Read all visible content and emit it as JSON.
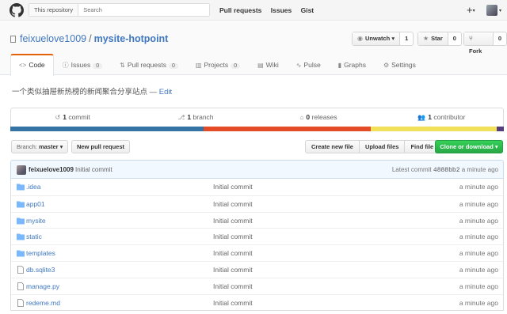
{
  "header": {
    "scope": "This repository",
    "search_placeholder": "Search",
    "nav": [
      "Pull requests",
      "Issues",
      "Gist"
    ],
    "plus": "+",
    "caret": "▾"
  },
  "repo": {
    "owner": "feixuelove1009",
    "separator": "/",
    "name": "mysite-hotpoint",
    "watch": {
      "label": "Unwatch ▾",
      "count": "1"
    },
    "star": {
      "label": "Star",
      "count": "0"
    },
    "fork": {
      "label": "Fork",
      "count": "0"
    }
  },
  "tabs": [
    {
      "label": "Code",
      "count": ""
    },
    {
      "label": "Issues",
      "count": "0"
    },
    {
      "label": "Pull requests",
      "count": "0"
    },
    {
      "label": "Projects",
      "count": "0"
    },
    {
      "label": "Wiki",
      "count": ""
    },
    {
      "label": "Pulse",
      "count": ""
    },
    {
      "label": "Graphs",
      "count": ""
    },
    {
      "label": "Settings",
      "count": ""
    }
  ],
  "description": {
    "text": "一个类似抽屉新热榜的新闻聚合分享站点",
    "dash": "—",
    "edit": "Edit"
  },
  "summary": {
    "commits": {
      "num": "1",
      "label": "commit"
    },
    "branches": {
      "num": "1",
      "label": "branch"
    },
    "releases": {
      "num": "0",
      "label": "releases"
    },
    "contributors": {
      "num": "1",
      "label": "contributor"
    }
  },
  "lang_colors": [
    "#3572a5",
    "#e34c26",
    "#f1e05a",
    "#563d7c"
  ],
  "lang_shares": [
    0.391,
    0.34,
    0.254,
    0.015
  ],
  "toolbar": {
    "branch_prefix": "Branch:",
    "branch": "master ▾",
    "new_pr": "New pull request",
    "create_file": "Create new file",
    "upload": "Upload files",
    "find": "Find file",
    "clone": "Clone or download ▾"
  },
  "commit": {
    "user": "feixuelove1009",
    "message": "Initial commit",
    "latest_label": "Latest commit",
    "sha": "4888bb2",
    "age": "a minute ago"
  },
  "files": [
    {
      "name": ".idea",
      "type": "folder",
      "message": "Initial commit",
      "age": "a minute ago"
    },
    {
      "name": "app01",
      "type": "folder",
      "message": "Initial commit",
      "age": "a minute ago"
    },
    {
      "name": "mysite",
      "type": "folder",
      "message": "Initial commit",
      "age": "a minute ago"
    },
    {
      "name": "static",
      "type": "folder",
      "message": "Initial commit",
      "age": "a minute ago"
    },
    {
      "name": "templates",
      "type": "folder",
      "message": "Initial commit",
      "age": "a minute ago"
    },
    {
      "name": "db.sqlite3",
      "type": "file",
      "message": "Initial commit",
      "age": "a minute ago"
    },
    {
      "name": "manage.py",
      "type": "file",
      "message": "Initial commit",
      "age": "a minute ago"
    },
    {
      "name": "redeme.md",
      "type": "file",
      "message": "Initial commit",
      "age": "a minute ago"
    }
  ]
}
